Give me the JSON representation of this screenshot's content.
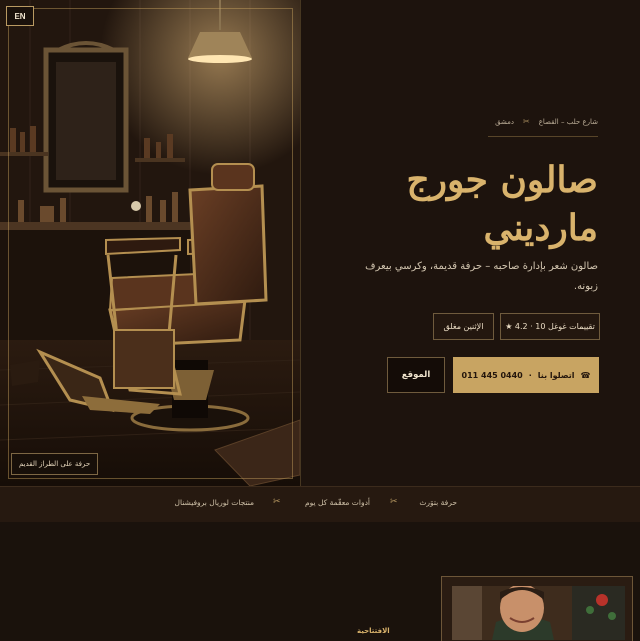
{
  "header": {
    "lang_label": "EN"
  },
  "hero": {
    "photo_caption": "حرفة على الطراز القديم",
    "breadcrumb": {
      "street": "شارع حلب – القصاع",
      "city": "دمشق"
    },
    "title_line1": "صالون جورج",
    "title_line2": "مارديني",
    "tagline": "صالون شعر بإدارة صاحبه – حرفة قديمة، وكرسي بيعرف زبونه.",
    "rating_label": "تقييمات غوغل 10 · 4.2 ★",
    "hours_label": "الإثنين مغلق",
    "call_label": "اتصلوا بنا",
    "call_number": "011 445 0440",
    "location_label": "الموقع"
  },
  "strip": {
    "items": [
      "حرفة بتوَرث",
      "أدوات معقّمة كل يوم",
      "منتجات لوريال بروفيشنال"
    ]
  },
  "lower": {
    "opening_label": "الافتتاحية"
  },
  "colors": {
    "accent": "#c8a462",
    "background": "#1d130d",
    "title": "#d9b36c"
  },
  "icons": {
    "separator": "scissors-icon",
    "phone": "phone-icon",
    "star": "star-icon"
  }
}
